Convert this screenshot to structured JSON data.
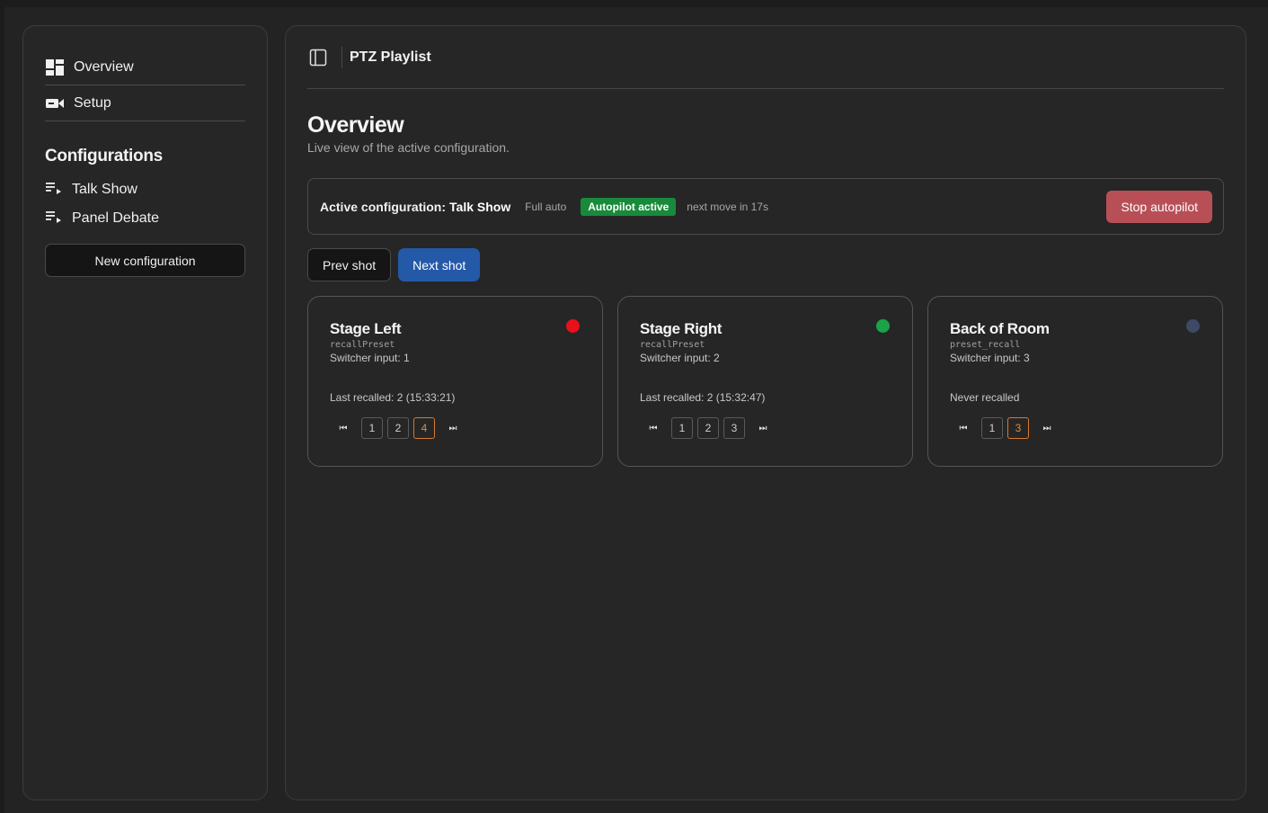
{
  "sidebar": {
    "nav": [
      {
        "label": "Overview",
        "icon": "dashboard-icon"
      },
      {
        "label": "Setup",
        "icon": "camera-icon"
      }
    ],
    "configurations_title": "Configurations",
    "configurations": [
      {
        "label": "Talk Show",
        "icon": "playlist-icon"
      },
      {
        "label": "Panel Debate",
        "icon": "playlist-icon"
      }
    ],
    "new_button": "New configuration"
  },
  "header": {
    "title": "PTZ Playlist"
  },
  "page": {
    "title": "Overview",
    "subtitle": "Live view of the active configuration."
  },
  "active": {
    "label": "Active configuration:",
    "name": "Talk Show",
    "mode": "Full auto",
    "badge": "Autopilot active",
    "next_move": "next move in 17s",
    "stop_button": "Stop autopilot"
  },
  "shot_controls": {
    "prev": "Prev shot",
    "next": "Next shot"
  },
  "colors": {
    "live": "#e8101a",
    "preview": "#1aa34a",
    "idle": "#3c4a66",
    "accent": "#d9782f",
    "primary": "#2459a8",
    "danger": "#b84f56"
  },
  "cards": [
    {
      "name": "Stage Left",
      "method": "recallPreset",
      "input": "Switcher input: 1",
      "recall": "Last recalled: 2 (15:33:21)",
      "status": "live",
      "pages": [
        "1",
        "2",
        "4"
      ],
      "active_page": "4"
    },
    {
      "name": "Stage Right",
      "method": "recallPreset",
      "input": "Switcher input: 2",
      "recall": "Last recalled: 2 (15:32:47)",
      "status": "preview",
      "pages": [
        "1",
        "2",
        "3"
      ],
      "active_page": ""
    },
    {
      "name": "Back of Room",
      "method": "preset_recall",
      "input": "Switcher input: 3",
      "recall": "Never recalled",
      "status": "idle",
      "pages": [
        "1",
        "3"
      ],
      "active_page": "3"
    }
  ]
}
